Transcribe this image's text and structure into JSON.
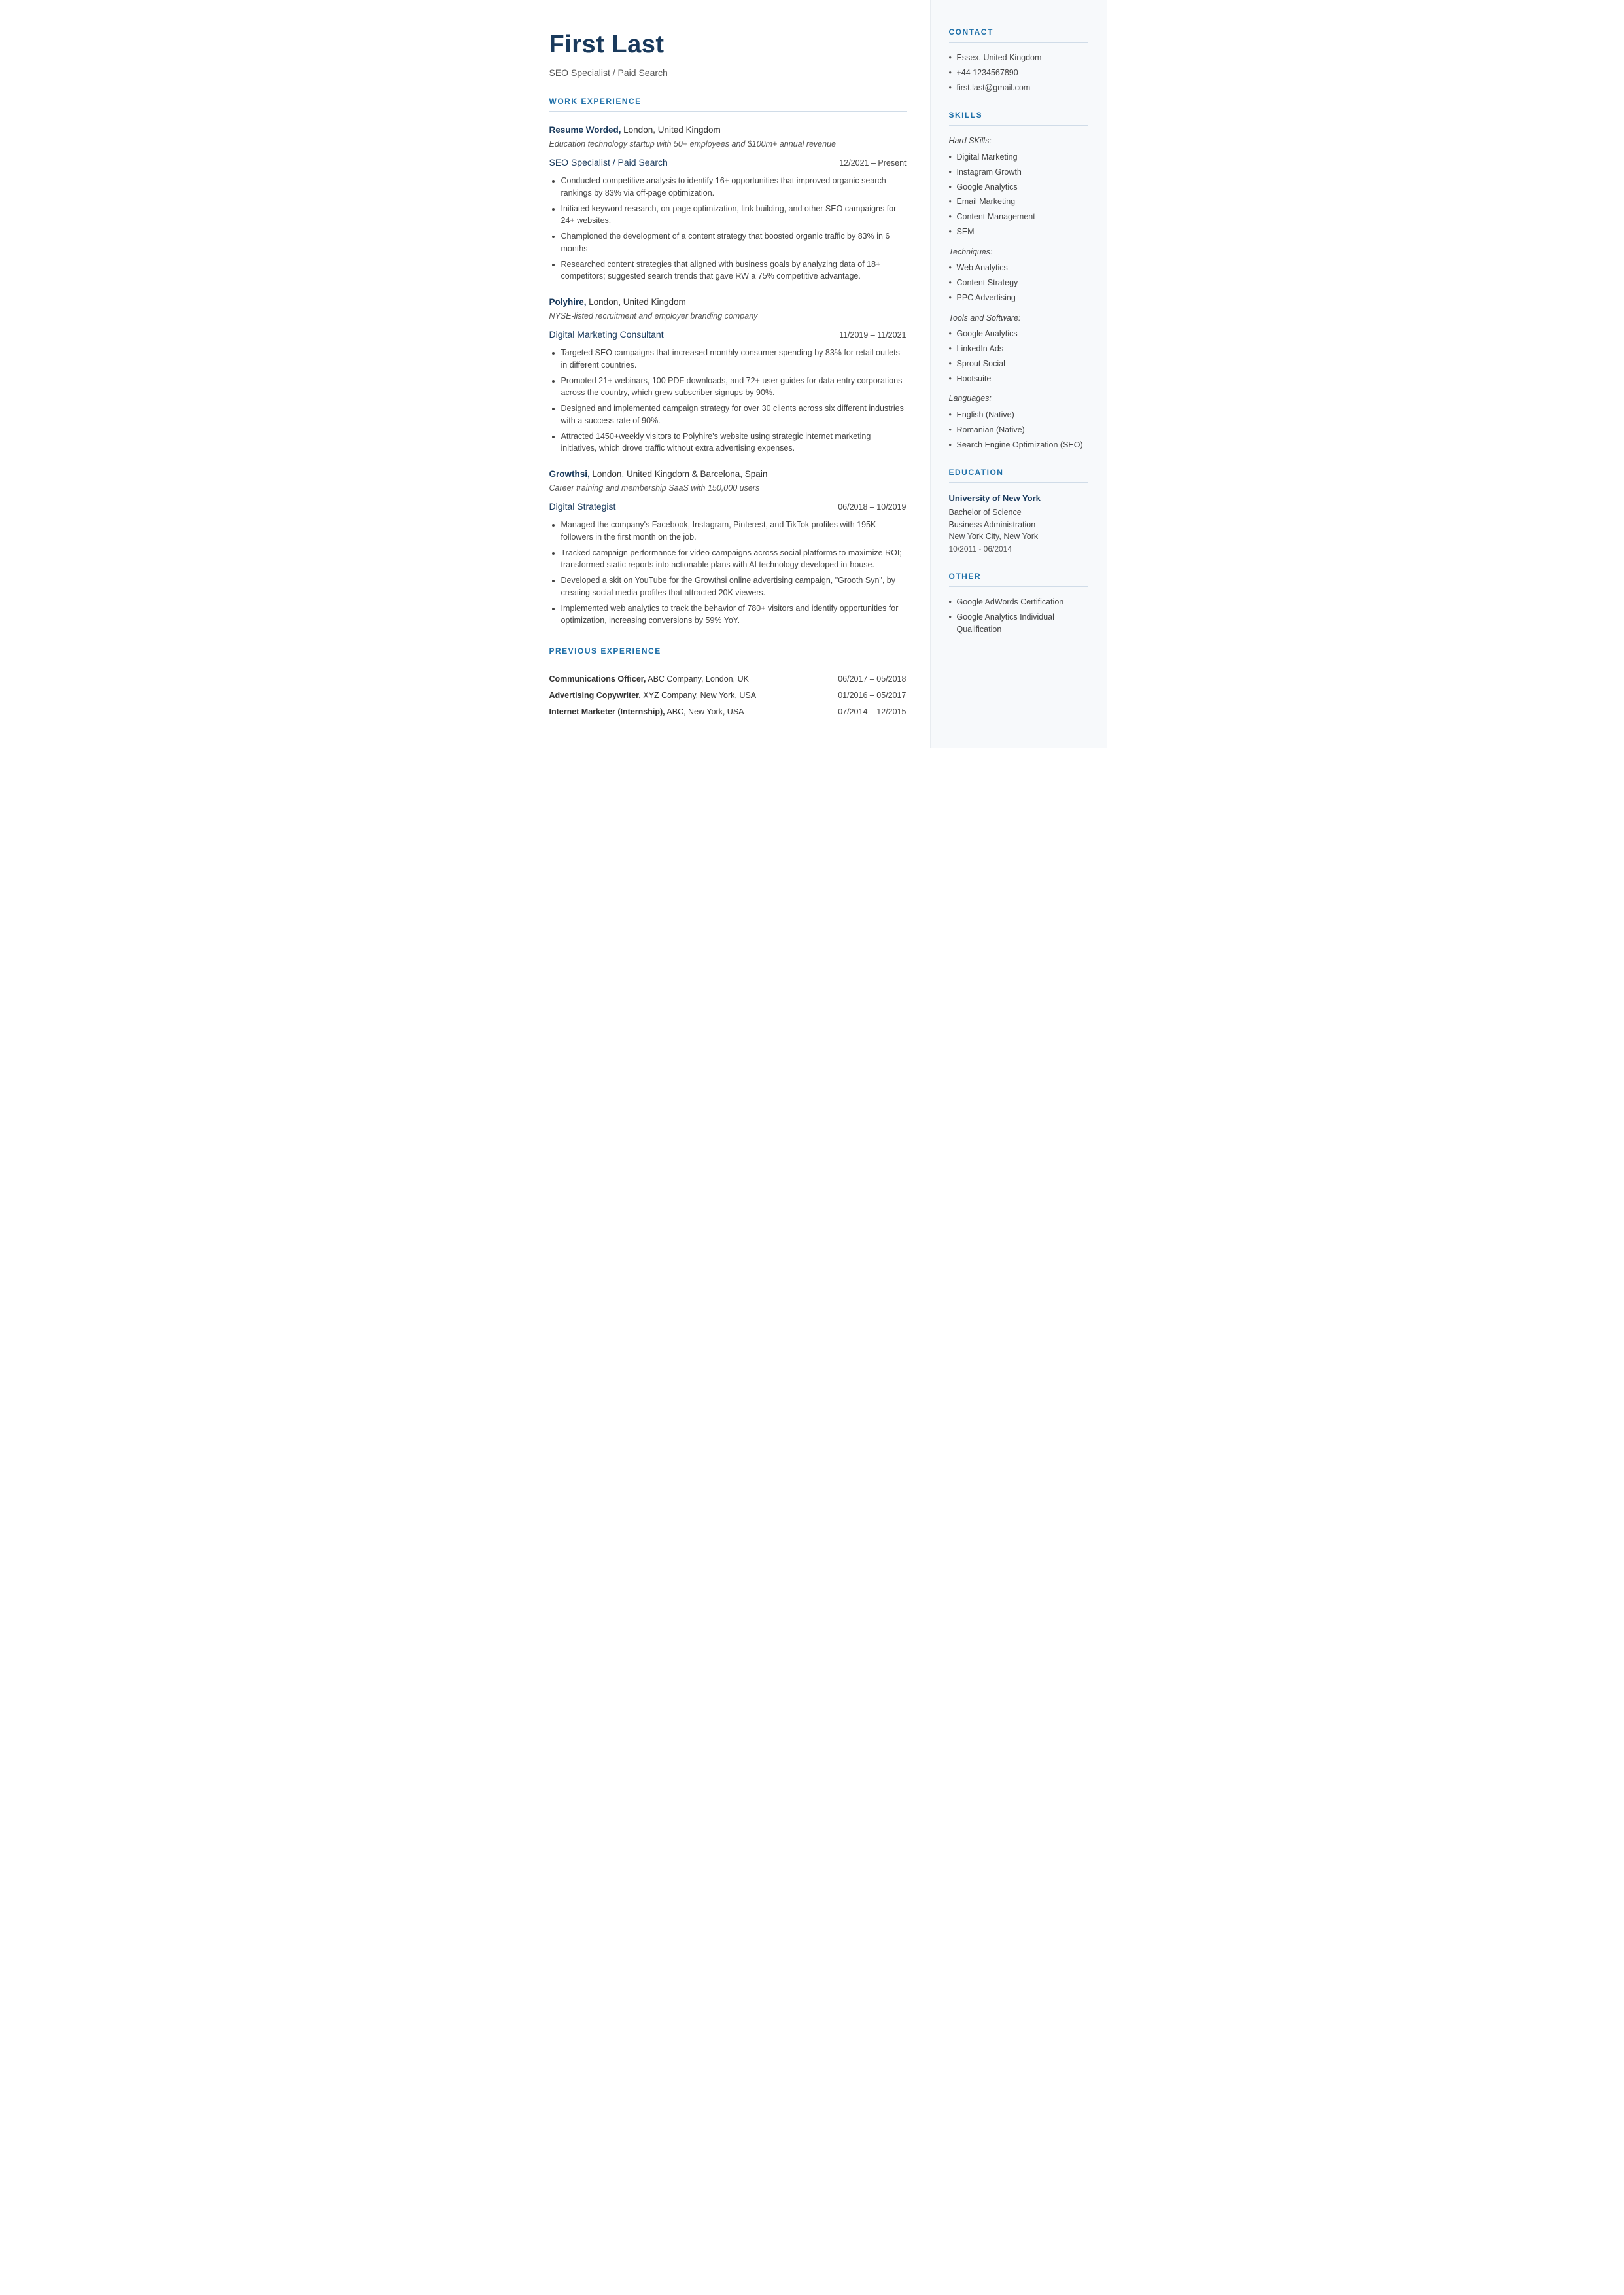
{
  "name": "First Last",
  "job_title": "SEO Specialist / Paid Search",
  "sections": {
    "work_experience_label": "WORK EXPERIENCE",
    "previous_experience_label": "PREVIOUS EXPERIENCE",
    "contact_label": "CONTACT",
    "skills_label": "SKILLS",
    "education_label": "EDUCATION",
    "other_label": "OTHER"
  },
  "work_experience": [
    {
      "company": "Resume Worded,",
      "location": "London, United Kingdom",
      "description": "Education technology startup with 50+ employees and $100m+ annual revenue",
      "role": "SEO Specialist / Paid Search",
      "dates": "12/2021 – Present",
      "bullets": [
        "Conducted competitive analysis to identify 16+ opportunities that improved organic search rankings by 83% via off-page optimization.",
        "Initiated keyword research, on-page optimization, link building, and other SEO campaigns for 24+ websites.",
        "Championed the development of a content strategy that boosted organic traffic by 83% in 6 months",
        "Researched content strategies that aligned with business goals by analyzing data of 18+ competitors; suggested search trends that gave RW a 75% competitive advantage."
      ]
    },
    {
      "company": "Polyhire,",
      "location": "London, United Kingdom",
      "description": "NYSE-listed recruitment and employer branding company",
      "role": "Digital Marketing Consultant",
      "dates": "11/2019 – 11/2021",
      "bullets": [
        "Targeted SEO campaigns that increased monthly consumer spending by 83% for retail outlets in different countries.",
        "Promoted 21+ webinars, 100 PDF downloads, and 72+ user guides for data entry corporations across the country, which grew subscriber signups by 90%.",
        "Designed and implemented campaign strategy for over 30 clients across six different industries with a success rate of 90%.",
        "Attracted 1450+weekly visitors to Polyhire's website using strategic internet marketing initiatives, which drove traffic without extra advertising expenses."
      ]
    },
    {
      "company": "Growthsi,",
      "location": "London, United Kingdom & Barcelona, Spain",
      "description": "Career training and membership SaaS with 150,000 users",
      "role": "Digital Strategist",
      "dates": "06/2018 – 10/2019",
      "bullets": [
        "Managed the company's Facebook, Instagram, Pinterest, and TikTok profiles with 195K followers in the first month on the job.",
        "Tracked campaign performance for video campaigns across social platforms to maximize ROI; transformed static reports into actionable plans with AI technology developed in-house.",
        "Developed a skit on YouTube for the Growthsi online advertising campaign, \"Grooth Syn\", by creating social media profiles that attracted 20K viewers.",
        "Implemented web analytics to track the behavior of 780+ visitors and identify opportunities for optimization, increasing conversions by 59% YoY."
      ]
    }
  ],
  "previous_experience": [
    {
      "title_bold": "Communications Officer,",
      "title_rest": " ABC Company, London, UK",
      "dates": "06/2017 – 05/2018"
    },
    {
      "title_bold": "Advertising Copywriter,",
      "title_rest": " XYZ Company, New York, USA",
      "dates": "01/2016 – 05/2017"
    },
    {
      "title_bold": "Internet Marketer (Internship),",
      "title_rest": " ABC, New York, USA",
      "dates": "07/2014 – 12/2015"
    }
  ],
  "contact": {
    "items": [
      "Essex, United Kingdom",
      "+44 1234567890",
      "first.last@gmail.com"
    ]
  },
  "skills": {
    "hard_skills_label": "Hard SKills:",
    "hard_skills": [
      "Digital Marketing",
      "Instagram Growth",
      "Google Analytics",
      "Email Marketing",
      "Content Management",
      "SEM"
    ],
    "techniques_label": "Techniques:",
    "techniques": [
      "Web Analytics",
      "Content Strategy",
      "PPC Advertising"
    ],
    "tools_label": "Tools and Software:",
    "tools": [
      "Google Analytics",
      "LinkedIn Ads",
      "Sprout Social",
      "Hootsuite"
    ],
    "languages_label": "Languages:",
    "languages": [
      "English (Native)",
      "Romanian (Native)",
      "Search Engine Optimization (SEO)"
    ]
  },
  "education": {
    "school": "University of New York",
    "degree": "Bachelor of Science",
    "field": "Business Administration",
    "location": "New York City, New York",
    "dates": "10/2011 - 06/2014"
  },
  "other": {
    "items": [
      "Google AdWords Certification",
      "Google Analytics Individual Qualification"
    ]
  }
}
